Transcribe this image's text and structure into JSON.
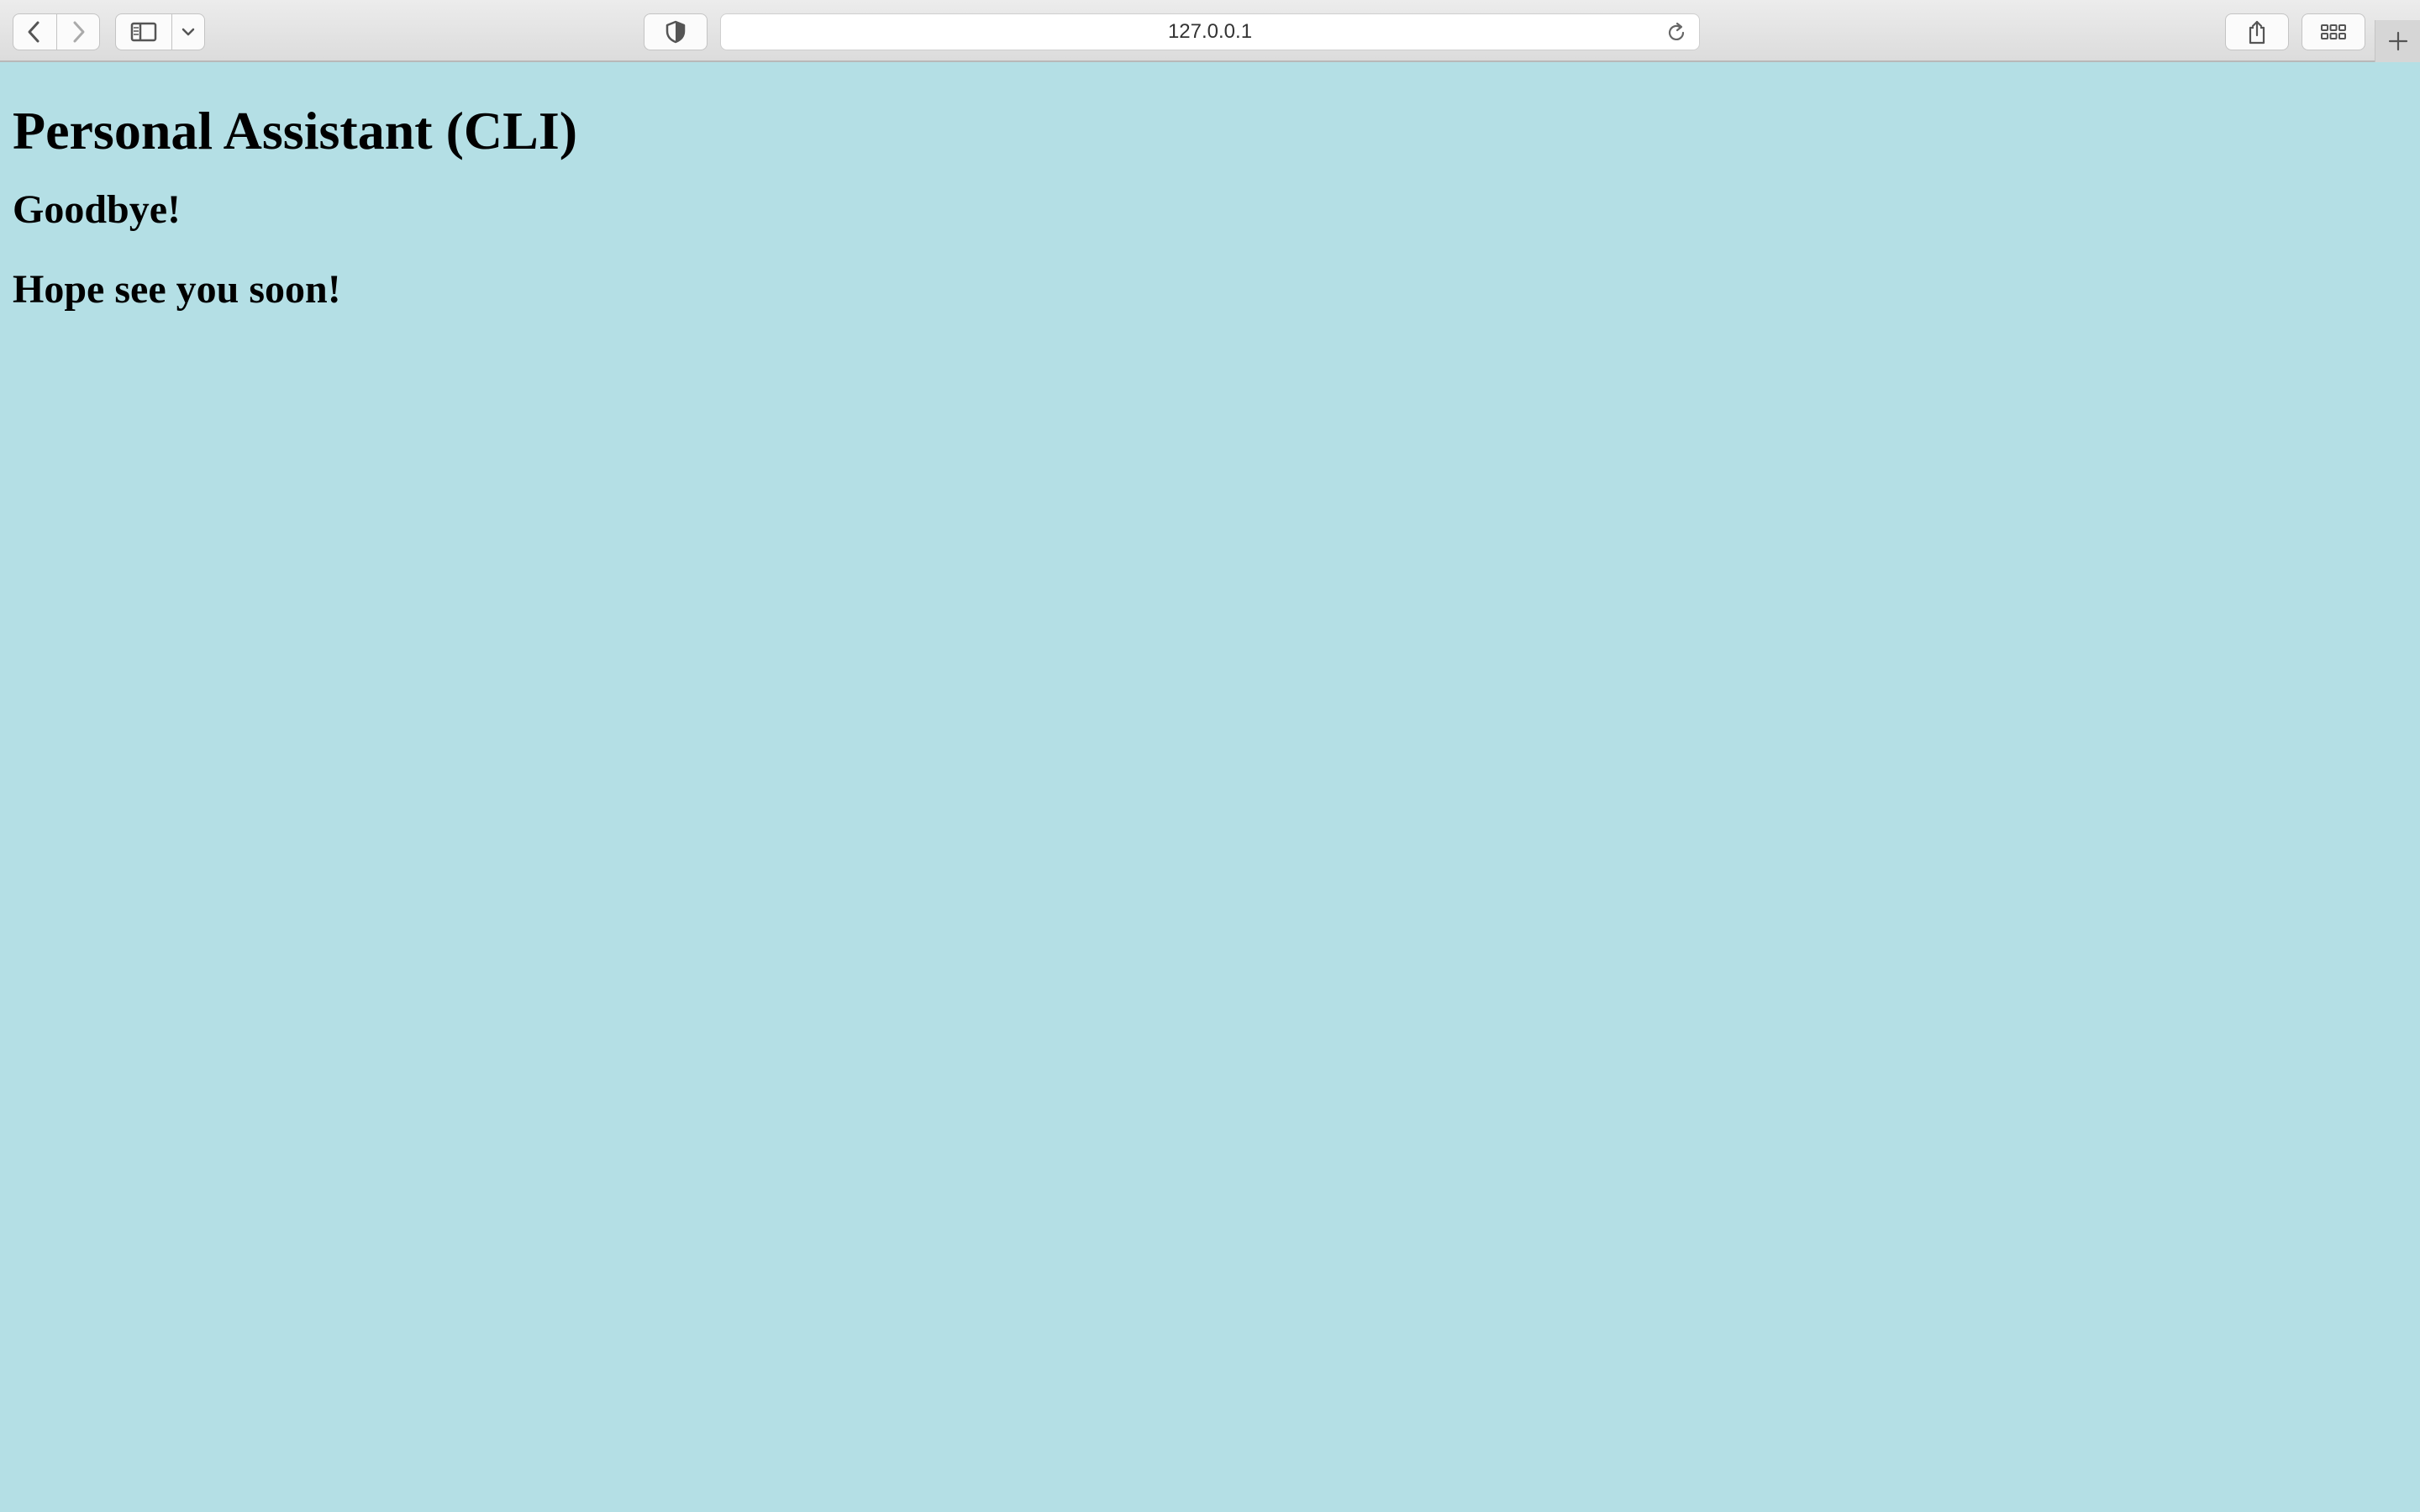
{
  "browser": {
    "url": "127.0.0.1",
    "icons": {
      "back": "chevron-left-icon",
      "forward": "chevron-right-icon",
      "sidebar": "sidebar-icon",
      "dropdown": "chevron-down-icon",
      "privacy": "shield-icon",
      "reload": "reload-icon",
      "share": "share-icon",
      "tabs": "grid-icon",
      "new_tab": "plus-icon"
    }
  },
  "page": {
    "title": "Personal Assistant (CLI)",
    "message": "Goodbye!",
    "farewell": "Hope see you soon!",
    "background_color": "#b4dfe5"
  }
}
